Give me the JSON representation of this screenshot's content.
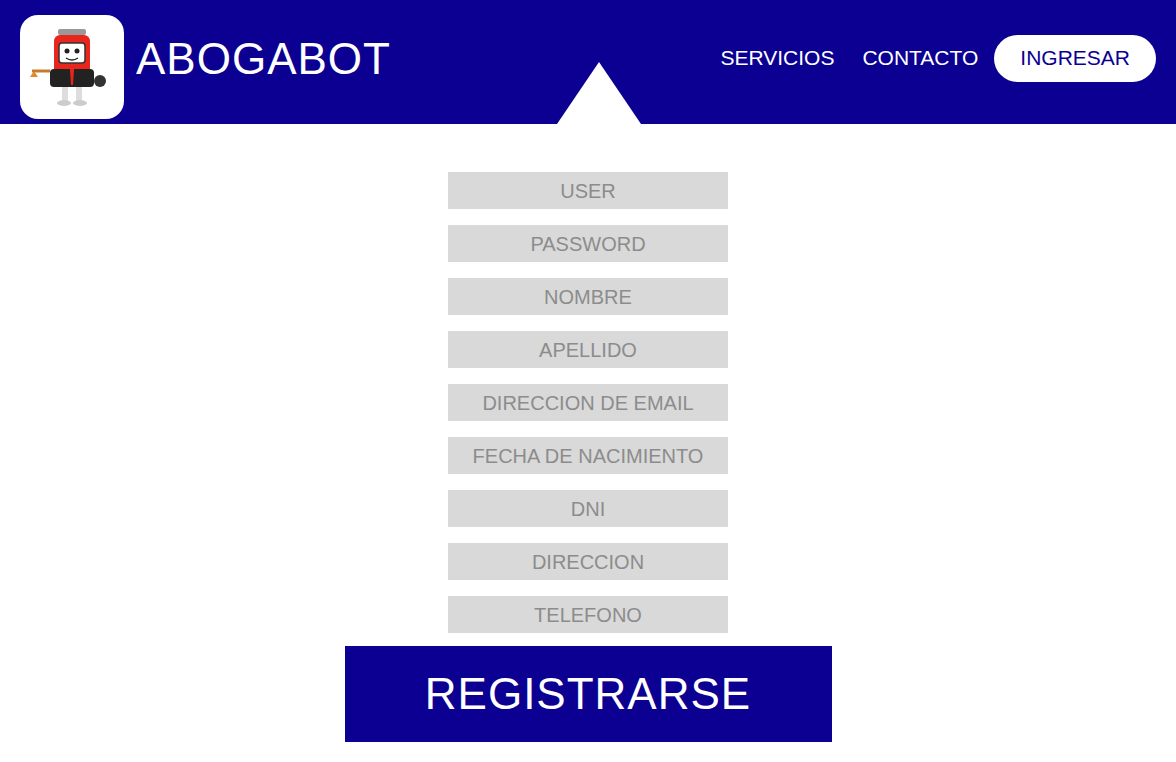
{
  "header": {
    "title": "ABOGABOT"
  },
  "nav": [
    {
      "label": "SERVICIOS"
    },
    {
      "label": "CONTACTO"
    }
  ],
  "login_button": "INGRESAR",
  "form": {
    "fields": [
      {
        "placeholder": "USER"
      },
      {
        "placeholder": "PASSWORD"
      },
      {
        "placeholder": "NOMBRE"
      },
      {
        "placeholder": "APELLIDO"
      },
      {
        "placeholder": "DIRECCION DE EMAIL"
      },
      {
        "placeholder": "FECHA DE NACIMIENTO"
      },
      {
        "placeholder": "DNI"
      },
      {
        "placeholder": "DIRECCION"
      },
      {
        "placeholder": "TELEFONO"
      }
    ],
    "submit": "REGISTRARSE"
  }
}
